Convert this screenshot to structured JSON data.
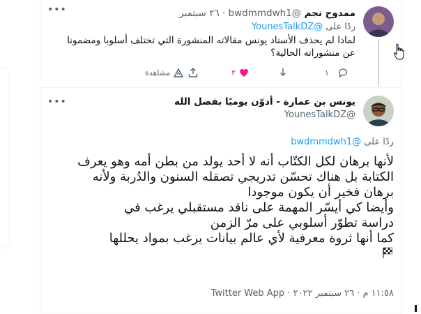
{
  "reply_tweet": {
    "display_name": "ممدوح نجم",
    "handle": "@bwdmmdwh1",
    "separator": "·",
    "date": "٢٦ سبتمبر",
    "replying_label": "ردًا على",
    "replying_handle": "@YounesTalkDZ",
    "body": "لماذا لم يحذف الأستاذ يونس مقالاته المنشورة التي تختلف أسلوبا ومضمونا عن منشوراته الحالية؟",
    "actions": {
      "reply_count": "١",
      "retweet_count": "",
      "like_count": "٢",
      "analytics_label": "مشاهدة"
    }
  },
  "main_tweet": {
    "display_name": "يونس بن عمارة - أدوّن يوميًا بفضل الله",
    "handle": "@YounesTalkDZ",
    "replying_label": "ردًا على",
    "replying_handle": "@bwdmmdwh1",
    "body_lines": [
      "لأنها برهان لكل الكتّاب أنه لا أحد يولد من بطن أمه وهو يعرف",
      "الكتابة بل هناك تحسّن تدريجي تصقله السنون والدُربة ولأنه",
      "برهان فخير أن يكون موجودا",
      "وأيضا كي أيسّر المهمة على ناقد مستقبلي يرغب في",
      "دراسة تطوّر أسلوبي على مرّ الزمن",
      "كما أنها ثروة معرفية لأي عالم بيانات يرغب بمواد يحللها"
    ],
    "timestamp": "١١:٥٨ م · ٢٦ سبتمبر ٢٠٢٢ · Twitter Web App"
  },
  "colors": {
    "accent": "#1d9bf0",
    "like": "#f91880",
    "muted": "#536471",
    "text": "#0f1419"
  },
  "icons": [
    "more-icon",
    "reply-icon",
    "retweet-icon",
    "like-icon",
    "share-icon",
    "analytics-icon",
    "checkered-flag-icon",
    "pointer-cursor-icon"
  ]
}
